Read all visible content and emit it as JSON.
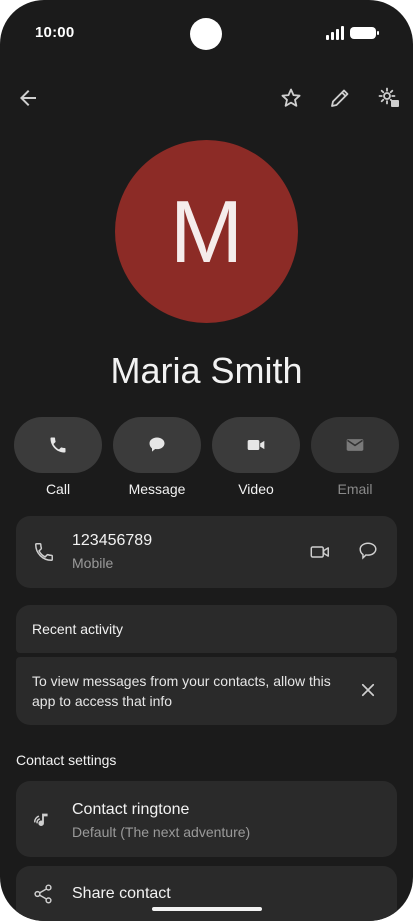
{
  "status_bar": {
    "time": "10:00"
  },
  "contact": {
    "initial": "M",
    "name": "Maria Smith"
  },
  "actions": [
    {
      "label": "Call"
    },
    {
      "label": "Message"
    },
    {
      "label": "Video"
    },
    {
      "label": "Email"
    }
  ],
  "phone": {
    "number": "123456789",
    "type": "Mobile"
  },
  "recent_activity": {
    "title": "Recent activity",
    "message": "To view messages from your contacts, allow this app to access that info"
  },
  "contact_settings": {
    "title": "Contact settings",
    "ringtone_label": "Contact ringtone",
    "ringtone_value": "Default (The next adventure)",
    "share_label": "Share contact"
  },
  "colors": {
    "background": "#1b1b1b",
    "card": "#2a2a2a",
    "avatar": "#8c2b26"
  }
}
